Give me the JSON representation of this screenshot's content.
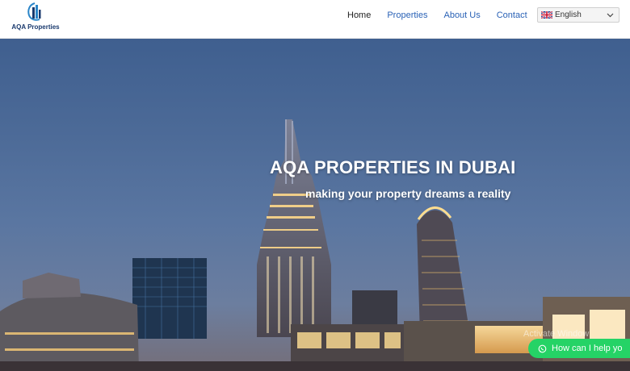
{
  "brand": {
    "name": "AQA Properties",
    "color": "#1a3a6e"
  },
  "nav": {
    "items": [
      {
        "label": "Home"
      },
      {
        "label": "Properties"
      },
      {
        "label": "About Us"
      },
      {
        "label": "Contact"
      }
    ],
    "link_color": "#2a62b6"
  },
  "language": {
    "selected": "English",
    "flag_icon": "uk-flag-icon"
  },
  "hero": {
    "title": "AQA PROPERTIES IN DUBAI",
    "subtitle": "making your property dreams a reality"
  },
  "os_watermark": "Activate Window",
  "whatsapp": {
    "label": "How can I help yo",
    "color": "#25d366",
    "icon": "whatsapp-icon"
  }
}
